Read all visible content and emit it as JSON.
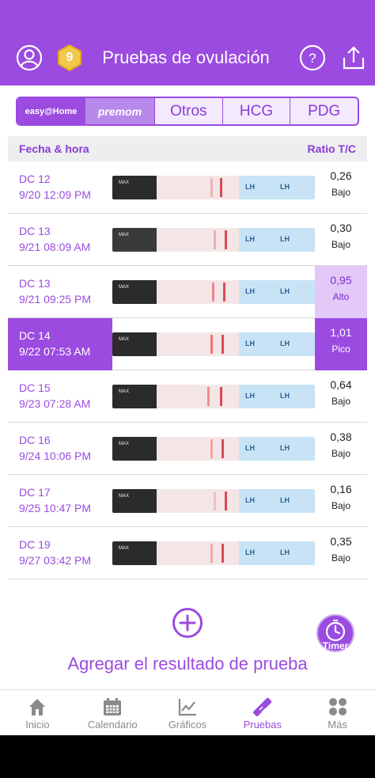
{
  "header": {
    "title": "Pruebas de ovulación",
    "coins": "9"
  },
  "brand_tabs": {
    "easy": "easy@Home",
    "premom": "premom",
    "otros": "Otros",
    "hcg": "HCG",
    "pdg": "PDG"
  },
  "columns": {
    "date": "Fecha & hora",
    "ratio": "Ratio T/C"
  },
  "strip_text": {
    "max": "MAX",
    "lh": "LH"
  },
  "rows": [
    {
      "dc": "DC 12",
      "datetime": "9/20   12:09 PM",
      "ratio": "0,26",
      "level": "Bajo"
    },
    {
      "dc": "DC 13",
      "datetime": "9/21   08:09 AM",
      "ratio": "0,30",
      "level": "Bajo"
    },
    {
      "dc": "DC 13",
      "datetime": "9/21   09:25 PM",
      "ratio": "0,95",
      "level": "Alto"
    },
    {
      "dc": "DC 14",
      "datetime": "9/22   07:53 AM",
      "ratio": "1,01",
      "level": "Pico"
    },
    {
      "dc": "DC 15",
      "datetime": "9/23   07:28 AM",
      "ratio": "0,64",
      "level": "Bajo"
    },
    {
      "dc": "DC 16",
      "datetime": "9/24   10:06 PM",
      "ratio": "0,38",
      "level": "Bajo"
    },
    {
      "dc": "DC 17",
      "datetime": "9/25   10:47 PM",
      "ratio": "0,16",
      "level": "Bajo"
    },
    {
      "dc": "DC 19",
      "datetime": "9/27   03:42 PM",
      "ratio": "0,35",
      "level": "Bajo"
    }
  ],
  "add": {
    "label": "Agregar el resultado de prueba"
  },
  "timer": {
    "label": "Timer"
  },
  "tabbar": {
    "home": "Inicio",
    "calendar": "Calendario",
    "charts": "Gráficos",
    "tests": "Pruebas",
    "more": "Más"
  },
  "colors": {
    "primary": "#9B4BE0",
    "alto_bg": "#e2c9f8"
  }
}
